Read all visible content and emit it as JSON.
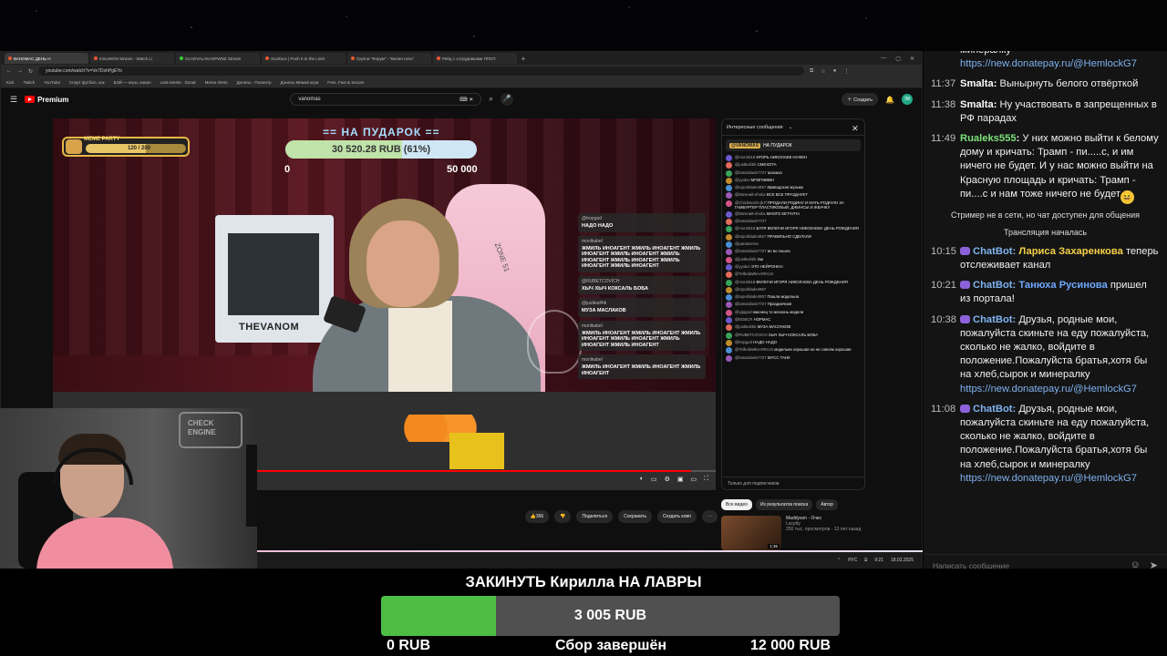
{
  "browser": {
    "tabs": [
      {
        "label": "ВАНОМАС ДЕНЬ Н",
        "active": true
      },
      {
        "label": "ImsoWON Stream - Watch Li"
      },
      {
        "label": "GLADVALAKASPWNZ Stream"
      },
      {
        "label": "Scarface | Push It to the Limit"
      },
      {
        "label": "Группа \"Форум\" - \"Белая ночь\""
      },
      {
        "label": "Рейд с сотрудниками ППСП"
      }
    ],
    "url": "youtube.com/watch?v=Ve7DshPgEYo",
    "bookmarks": [
      "Kick",
      "Twitch",
      "YouTube",
      "Спорт футбол, хок",
      "БЭЙ — игры, канал",
      "Last events · Donat",
      "Meme Alerts",
      "Донаты - Посмотр",
      "Донаты Мемов игра",
      "Free, Fast & Secure"
    ]
  },
  "youtube": {
    "brand": "Premium",
    "search_value": "vanomas",
    "create_label": "Создать",
    "avatar_initials": "ЭК",
    "actions": {
      "likes": "356",
      "share": "Поделиться",
      "save": "Сохранить",
      "clip": "Создать клип"
    },
    "rec_tabs": [
      "Все видео",
      "Из результатов поиска",
      "Автор"
    ],
    "rec": {
      "title": "Maddyson - Очко",
      "channel": "Lacplty",
      "meta": "250 тыс. просмотров · 13 лет назад",
      "duration": "1:36"
    },
    "taskbar": {
      "lang": "РУС",
      "time": "9:21",
      "date": "18.02.2025"
    }
  },
  "overlay": {
    "goal_title": "== НА ПУДАРОК ==",
    "goal_value": "30 520.28 RUB (61%)",
    "goal_fraction": 0.61,
    "goal_min": "0",
    "goal_max": "50 000",
    "meme_label": "MEME PARTY",
    "meme_count": "120 / 200",
    "meme_fraction": 0.6,
    "pc_label": "THEVANOM",
    "chair_label": "ZONE 51",
    "cam_sign": "CHECK ENGINE",
    "chat": [
      {
        "user": "@tropgod",
        "text": "НАДО НАДО"
      },
      {
        "user": "monlkabel",
        "text": "ЖМИЛЬ ИНОАГЕНТ ЖМИЛЬ ИНОАГЕНТ ЖМИЛЬ ИНОАГЕНТ ЖМИЛЬ ИНОАГЕНТ ЖМИЛЬ ИНОАГЕНТ ЖМИЛЬ ИНОАГЕНТ ЖМИЛЬ ИНОАГЕНТ ЖМИЛЬ ИНОАГЕНТ"
      },
      {
        "user": "@RUBETCOVICH",
        "text": "ХЫЧ ХЫЧ КОКСАЛЬ БОБА"
      },
      {
        "user": "@justleaf4ik",
        "text": "МУЗА МАСЛАКОВ"
      },
      {
        "user": "monlkabel",
        "text": "ЖМИЛЬ ИНОАГЕНТ ЖМИЛЬ ИНОАГЕНТ ЖМИЛЬ ИНОАГЕНТ ЖМИЛЬ ИНОАГЕНТ ЖМИЛЬ ИНОАГЕНТ ЖМИЛЬ ИНОАГЕНТ"
      },
      {
        "user": "monlkabel",
        "text": "ЖМИЛЬ ИНОАГЕНТ ЖМИЛЬ ИНОАГЕНТ ЖМИЛЬ ИНОАГЕНТ"
      }
    ]
  },
  "ytchat": {
    "header": "Интересные сообщения",
    "pinned_user": "@VANOMAS",
    "pinned_text": "НА ПУДАРОК",
    "footer": "Только для подписчиков",
    "messages": [
      {
        "user": "@mon2618",
        "text": "ИГОРЬ НИКОЛАЕВ НУЖЕН"
      },
      {
        "user": "@justleaf4ik",
        "text": "СМЕХОТА"
      },
      {
        "user": "@lamardavis7727",
        "text": "ахахаха"
      },
      {
        "user": "@yyukei",
        "text": "МГМГМММН"
      },
      {
        "user": "@toporblade4957",
        "text": "Ираводская музыка"
      },
      {
        "user": "@Евгений-ehobx",
        "text": "ВСЕ ВСЕ ПРАЗДНУЕТ"
      },
      {
        "user": "@ChickNorris-jk7f",
        "text": "ПРОДАЛИ РОДИНУ И МАТЬ РОДНУЮ ЗА ГАМБУРГЕР ПЛАСТИКОВЫЙ, ДЖИНСЫ И ЖВАЧКУ"
      },
      {
        "user": "@Евгений-ehobx",
        "text": "МНОГО КЕТЧУПА"
      },
      {
        "user": "@lamardavis7727",
        "text": ""
      },
      {
        "user": "@mon2618",
        "text": "БАТЯ ВКЛЮЧИ ИГОРЯ НИКОЛАЕВА ДЕНЬ РОЖДЕНИЯ"
      },
      {
        "user": "@toporblade4957",
        "text": "ПРАВИЛЬНО СДЕЛАЛИ"
      },
      {
        "user": "@panamerso",
        "text": ""
      },
      {
        "user": "@lamardavis7727",
        "text": "во во пошли"
      },
      {
        "user": "@justleaf4ik",
        "text": "ХЫ"
      },
      {
        "user": "@yyukei",
        "text": "ЭТО НЕЙРОНКА!"
      },
      {
        "user": "@TelfedaWkAARKUS",
        "text": ""
      },
      {
        "user": "@mon2618",
        "text": "ВКЛЮЧИ ИГОРЯ НИКОЛАЕВА ДЕНЬ РОЖДЕНИЯ"
      },
      {
        "user": "@toporblade4957",
        "text": ""
      },
      {
        "user": "@toporblade4957",
        "text": "Пошла модельна"
      },
      {
        "user": "@lamardavis7727",
        "text": "Праздничная"
      },
      {
        "user": "@vgagod",
        "text": "наконец то жесконь модели"
      },
      {
        "user": "@EDBCR",
        "text": "НОРМАС"
      },
      {
        "user": "@justleaf4ik",
        "text": "МУЗА МАСЛАКОВ"
      },
      {
        "user": "@RUBETCOVICH",
        "text": "ХЫЧ ХЫЧ КОКСАЛЬ БОБА"
      },
      {
        "user": "@tropgod",
        "text": "НАДО НАДО"
      },
      {
        "user": "@TelfedaWkAARKUS",
        "text": "модельна хорошая но не совсем хорошая"
      },
      {
        "user": "@lamardavis7727",
        "text": "МУСС ТАНК"
      }
    ]
  },
  "rchat": {
    "messages": [
      {
        "time": "",
        "user": "",
        "user_color": "#fff",
        "text": "минералку",
        "link": "https://new.donatepay.ru/@HemlockG7"
      },
      {
        "time": "11:37",
        "user": "Smalta",
        "user_color": "#fff",
        "text": "Вынырнуть белого отвёрткой",
        "link": ""
      },
      {
        "time": "11:38",
        "user": "Smalta",
        "user_color": "#fff",
        "text": "Ну участвовать в запрещенных в РФ парадах",
        "link": ""
      },
      {
        "time": "11:49",
        "user": "Rualeks555",
        "user_color": "#7ce07a",
        "text": "У них можно выйти к белому дому и кричать: Трамп - пи.....с, и им ничего не будет. И у нас можно выйти на Красную площадь и кричать: Трамп - пи....с и нам тоже ничего не будет",
        "link": "",
        "emoji": true
      }
    ],
    "system": [
      "Стример не в сети, но чат доступен для общения",
      "Трансляция началась"
    ],
    "bot_messages": [
      {
        "time": "10:15",
        "user": "ChatBot",
        "highlight": "Лариса Захаренкова",
        "hl_color": "#f7d14a",
        "text": "теперь отслеживает канал",
        "link": ""
      },
      {
        "time": "10:21",
        "user": "ChatBot",
        "highlight": "Танюха Русинова",
        "hl_color": "#6fa8ff",
        "text": "пришел из портала!",
        "link": ""
      },
      {
        "time": "10:38",
        "user": "ChatBot",
        "highlight": "",
        "hl_color": "",
        "text": "Друзья, родные мои, пожалуйста скиньте на еду пожалуйста, сколько не жалко, войдите в положение.Пожалуйста братья,хотя бы на хлеб,сырок и минералку",
        "link": "https://new.donatepay.ru/@HemlockG7"
      },
      {
        "time": "11:08",
        "user": "ChatBot",
        "highlight": "",
        "hl_color": "",
        "text": "Друзья, родные мои, пожалуйста скиньте на еду пожалуйста, сколько не жалко, войдите в положение.Пожалуйста братья,хотя бы на хлеб,сырок и минералку",
        "link": "https://new.donatepay.ru/@HemlockG7"
      }
    ],
    "input_placeholder": "Написать сообщение",
    "bot_color": "#7fb2f0"
  },
  "donation": {
    "title": "ЗАКИНУТЬ Кирилла НА ЛАВРЫ",
    "value": "3 005  RUB",
    "fraction": 0.25,
    "min": "0 RUB",
    "status": "Сбор завершён",
    "max": "12 000 RUB",
    "fill_color": "#4dbd44"
  }
}
